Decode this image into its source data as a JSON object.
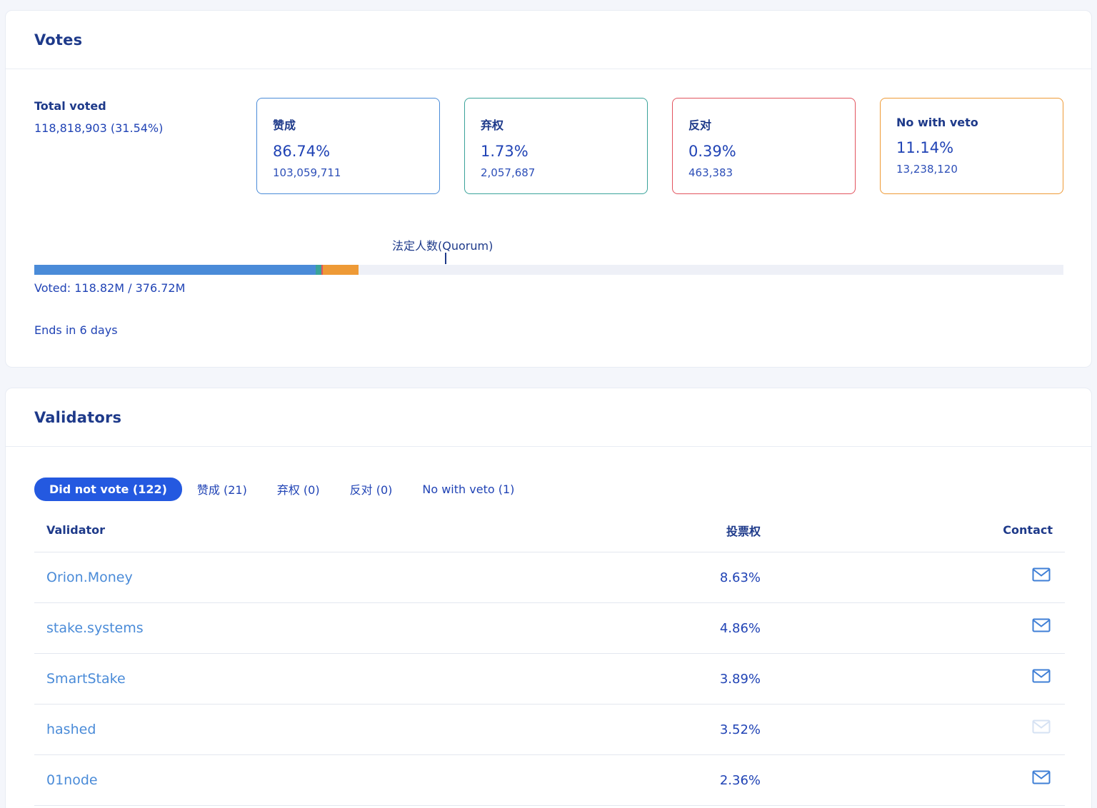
{
  "votes": {
    "title": "Votes",
    "total_label": "Total voted",
    "total_value": "118,818,903 (31.54%)",
    "options": [
      {
        "name": "赞成",
        "pct": "86.74%",
        "count": "103,059,711",
        "color": "#4a8bd8"
      },
      {
        "name": "弃权",
        "pct": "1.73%",
        "count": "2,057,687",
        "color": "#3aa39a"
      },
      {
        "name": "反对",
        "pct": "0.39%",
        "count": "463,383",
        "color": "#e2535e"
      },
      {
        "name": "No with veto",
        "pct": "11.14%",
        "count": "13,238,120",
        "color": "#ee9a36"
      }
    ],
    "quorum_label": "法定人数(Quorum)",
    "progress_fraction": 0.3154,
    "voted_text": "Voted: 118.82M / 376.72M",
    "ends_text": "Ends in 6 days"
  },
  "validators": {
    "title": "Validators",
    "tabs": [
      {
        "label": "Did not vote (122)",
        "active": true
      },
      {
        "label": "赞成 (21)",
        "active": false
      },
      {
        "label": "弃权 (0)",
        "active": false
      },
      {
        "label": "反对 (0)",
        "active": false
      },
      {
        "label": "No with veto (1)",
        "active": false
      }
    ],
    "columns": {
      "name": "Validator",
      "power": "投票权",
      "contact": "Contact"
    },
    "rows": [
      {
        "name": "Orion.Money",
        "power": "8.63%",
        "contact_icon": "mail-icon",
        "contact_enabled": true
      },
      {
        "name": "stake.systems",
        "power": "4.86%",
        "contact_icon": "mail-icon",
        "contact_enabled": true
      },
      {
        "name": "SmartStake",
        "power": "3.89%",
        "contact_icon": "mail-icon",
        "contact_enabled": true
      },
      {
        "name": "hashed",
        "power": "3.52%",
        "contact_icon": "mail-icon",
        "contact_enabled": false
      },
      {
        "name": "01node",
        "power": "2.36%",
        "contact_icon": "mail-icon",
        "contact_enabled": true
      }
    ]
  }
}
